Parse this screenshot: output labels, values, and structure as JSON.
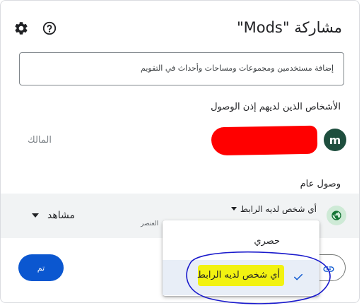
{
  "dialog": {
    "title": "مشاركة \"Mods\"",
    "add_placeholder": "إضافة مستخدمين ومجموعات ومساحات وأحداث في التقويم",
    "people_section_label": "الأشخاص الذين لديهم إذن الوصول",
    "general_access_label": "وصول عام"
  },
  "header": {
    "settings_icon": "gear-icon",
    "help_icon": "help-icon"
  },
  "people": [
    {
      "avatar_letter": "m",
      "role_label": "المالك",
      "name_redacted": true
    }
  ],
  "general_access": {
    "selected": "أي شخص لديه الرابط",
    "hint": "العنصر",
    "role": "مشاهد",
    "icon": "globe-icon"
  },
  "dropdown": {
    "options": [
      "حصري",
      "أي شخص لديه الرابط"
    ],
    "selected_index": 1
  },
  "footer": {
    "done_label": "تم",
    "copy_icon": "link-icon"
  },
  "colors": {
    "accent": "#0b57d0",
    "redaction": "#ff0000",
    "highlight": "#f2f211",
    "annotation": "#1a1acc"
  }
}
